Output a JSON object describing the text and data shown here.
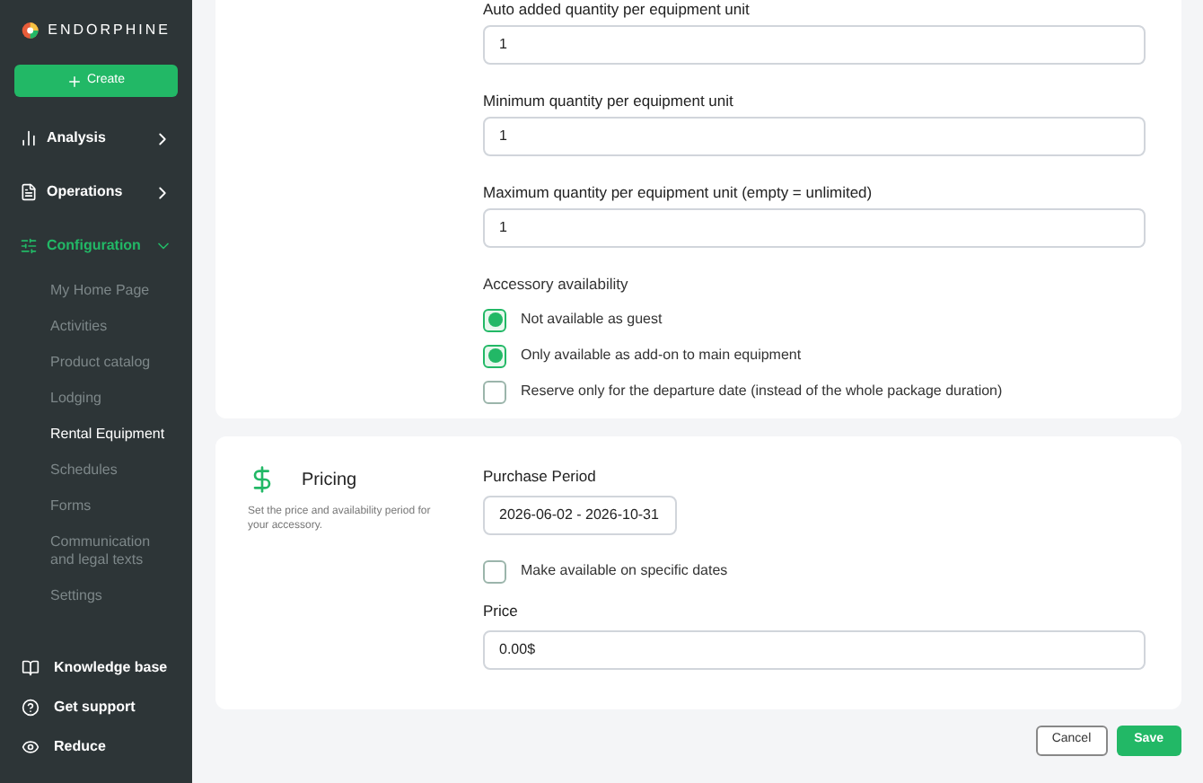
{
  "brand": {
    "name": "ENDORPHINE"
  },
  "create_button": {
    "label": "Create"
  },
  "nav": [
    {
      "label": "Analysis",
      "expanded": false
    },
    {
      "label": "Operations",
      "expanded": false
    },
    {
      "label": "Configuration",
      "expanded": true,
      "children": [
        {
          "label": "My Home Page",
          "selected": false
        },
        {
          "label": "Activities",
          "selected": false
        },
        {
          "label": "Product catalog",
          "selected": false
        },
        {
          "label": "Lodging",
          "selected": false
        },
        {
          "label": "Rental Equipment",
          "selected": true
        },
        {
          "label": "Schedules",
          "selected": false
        },
        {
          "label": "Forms",
          "selected": false
        },
        {
          "label": "Communication and legal texts",
          "selected": false
        },
        {
          "label": "Settings",
          "selected": false
        }
      ]
    }
  ],
  "footer_nav": [
    {
      "label": "Knowledge base"
    },
    {
      "label": "Get support"
    },
    {
      "label": "Reduce"
    }
  ],
  "quantity_fields": [
    {
      "label": "Auto added quantity per equipment unit",
      "value": "1"
    },
    {
      "label": "Minimum quantity per equipment unit",
      "value": "1"
    },
    {
      "label": "Maximum quantity per equipment unit (empty = unlimited)",
      "value": "1"
    }
  ],
  "availability": {
    "title": "Accessory availability",
    "options": [
      {
        "label": "Not available as guest",
        "checked": true
      },
      {
        "label": "Only available as add-on to main equipment",
        "checked": true
      },
      {
        "label": "Reserve only for the departure date (instead of the whole package duration)",
        "checked": false
      }
    ]
  },
  "pricing": {
    "title": "Pricing",
    "description": "Set the price and availability period for your accessory.",
    "period_label": "Purchase Period",
    "period_value": "2026-06-02 - 2026-10-31",
    "specific_dates": {
      "label": "Make available on specific dates",
      "checked": false
    },
    "price_label": "Price",
    "price_value": "0.00$"
  },
  "actions": {
    "cancel": "Cancel",
    "save": "Save"
  }
}
